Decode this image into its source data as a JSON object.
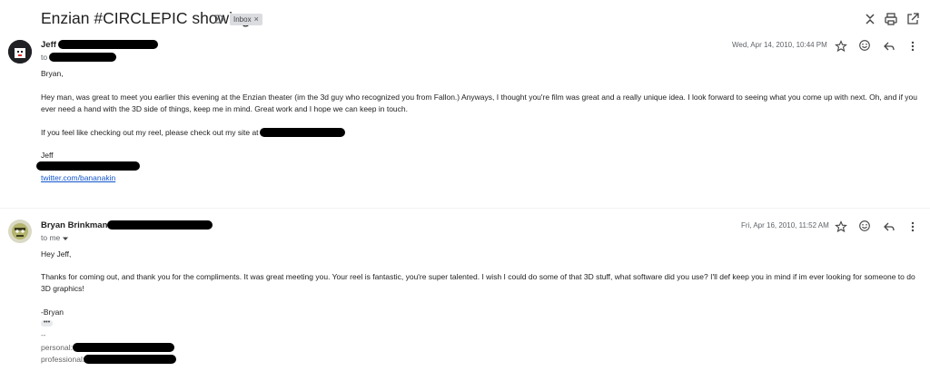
{
  "thread": {
    "subject": "Enzian #CIRCLEPIC showing",
    "label": "Inbox",
    "label_close": "×"
  },
  "messages": [
    {
      "sender": "Jeff",
      "to_prefix": "to",
      "date": "Wed, Apr 14, 2010, 10:44 PM",
      "greeting": "Bryan,",
      "paragraph1": "Hey man, was great to meet you earlier this evening at the Enzian theater (im the 3d guy who recognized you from Fallon.) Anyways, I thought you're film was great and a really unique idea. I look forward to seeing what you come up with next. Oh, and if you ever need a hand with the 3D side of things, keep me in mind. Great work and I hope we can keep in touch.",
      "paragraph2": "If you feel like checking out my reel, please check out my site at",
      "signature": "Jeff",
      "link": "twitter.com/bananakin"
    },
    {
      "sender": "Bryan Brinkman",
      "to_label": "to me",
      "date": "Fri, Apr 16, 2010, 11:52 AM",
      "greeting": "Hey Jeff,",
      "paragraph1": "Thanks for coming out, and thank you for the compliments. It was great meeting you. Your reel is fantastic, you're super talented. I wish I could do some of that 3D stuff, what software did you use? I'll def keep you in mind if im ever looking for someone to do 3D graphics!",
      "signoff": "-Bryan",
      "dots": "•••",
      "sig_sep": "--",
      "personal_label": "personal:",
      "professional_label": "professional:"
    }
  ],
  "icons": [
    "label-important-icon",
    "collapse-icon",
    "print-icon",
    "open-in-new-icon",
    "star-icon",
    "emoji-icon",
    "reply-icon",
    "more-vert-icon",
    "chevron-down-icon"
  ]
}
